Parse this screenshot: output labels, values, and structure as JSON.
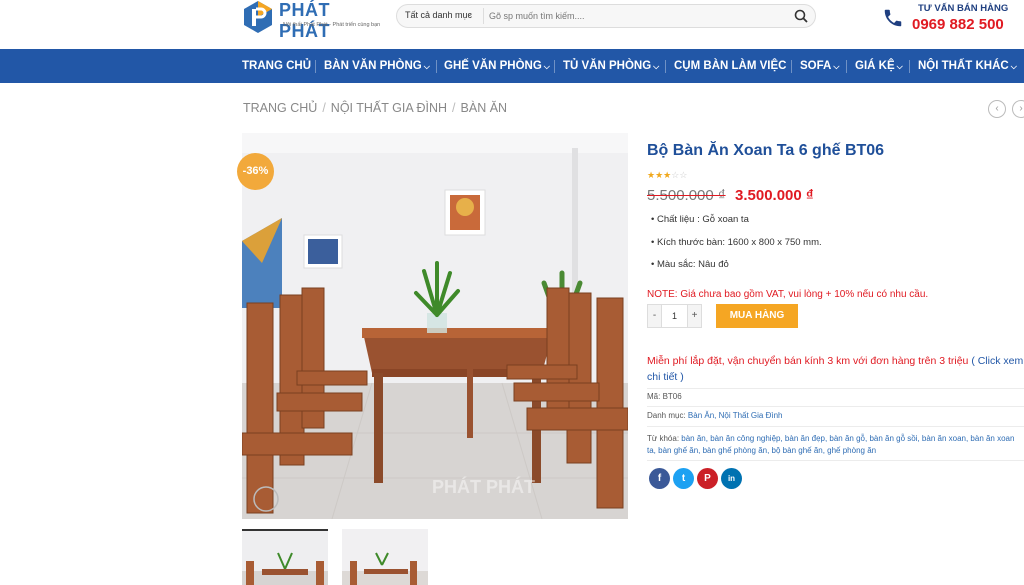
{
  "header": {
    "logo_text": "PHÁT PHÁT",
    "logo_tagline": "Nội thất Phát Phát - Phát triển cùng bạn",
    "search_category": "Tất cả danh mục",
    "search_placeholder": "Gõ sp muốn tìm kiếm....",
    "hotline_label": "TƯ VẤN BÁN HÀNG",
    "hotline_number": "0969 882 500"
  },
  "nav": {
    "items": [
      {
        "label": "TRANG CHỦ"
      },
      {
        "label": "BÀN VĂN PHÒNG"
      },
      {
        "label": "GHẾ VĂN PHÒNG"
      },
      {
        "label": "TỦ VĂN PHÒNG"
      },
      {
        "label": "CỤM BÀN LÀM VIỆC"
      },
      {
        "label": "SOFA"
      },
      {
        "label": "GIÁ KỆ"
      },
      {
        "label": "NỘI THẤT KHÁC"
      }
    ]
  },
  "breadcrumb": [
    "TRANG CHỦ",
    "NỘI THẤT GIA ĐÌNH",
    "BÀN ĂN"
  ],
  "product": {
    "sale_badge": "-36%",
    "title": "Bộ Bàn Ăn Xoan Ta 6 ghế BT06",
    "rating_stars": 3,
    "rating_max": 5,
    "price_old": "5.500.000 ₫",
    "price_new": "3.500.000 ₫",
    "specs": [
      "Chất liệu : Gỗ xoan ta",
      "Kích thước bàn: 1600 x 800 x 750 mm.",
      "Màu sắc: Nâu đỏ"
    ],
    "note": "NOTE: Giá chưa bao gồm VAT, vui lòng + 10% nếu có nhu cầu.",
    "qty_minus": "-",
    "qty_value": "1",
    "qty_plus": "+",
    "buy_label": "MUA HÀNG",
    "free_ship": "Miễn phí lắp đặt, vận chuyển bán kính 3 km với đơn hàng trên 3 triệu",
    "free_ship_link": "( Click xem chi tiết )",
    "sku_label": "Mã:",
    "sku": "BT06",
    "category_label": "Danh mục:",
    "categories": "Bàn Ăn, Nội Thất Gia Đình",
    "tags_label": "Từ khóa:",
    "tags": "bàn ăn, bàn ăn công nghiệp, bàn ăn đẹp, bàn ăn gỗ, bàn ăn gỗ sồi, bàn ăn xoan, bàn ăn xoan ta, bàn ghế ăn, bàn ghế phòng ăn, bộ bàn ghế ăn, ghế phòng ăn",
    "watermark": "PHÁT PHÁT"
  },
  "share": [
    {
      "icon": "facebook-icon",
      "glyph": "f",
      "color": "#3b5998"
    },
    {
      "icon": "twitter-icon",
      "glyph": "t",
      "color": "#1da1f2"
    },
    {
      "icon": "pinterest-icon",
      "glyph": "P",
      "color": "#cb2027"
    },
    {
      "icon": "linkedin-icon",
      "glyph": "in",
      "color": "#0072b1"
    }
  ],
  "colors": {
    "brand_blue": "#2257a7",
    "price_red": "#e01a22",
    "buy_orange": "#f5a623",
    "badge_orange": "#f2a93b"
  }
}
